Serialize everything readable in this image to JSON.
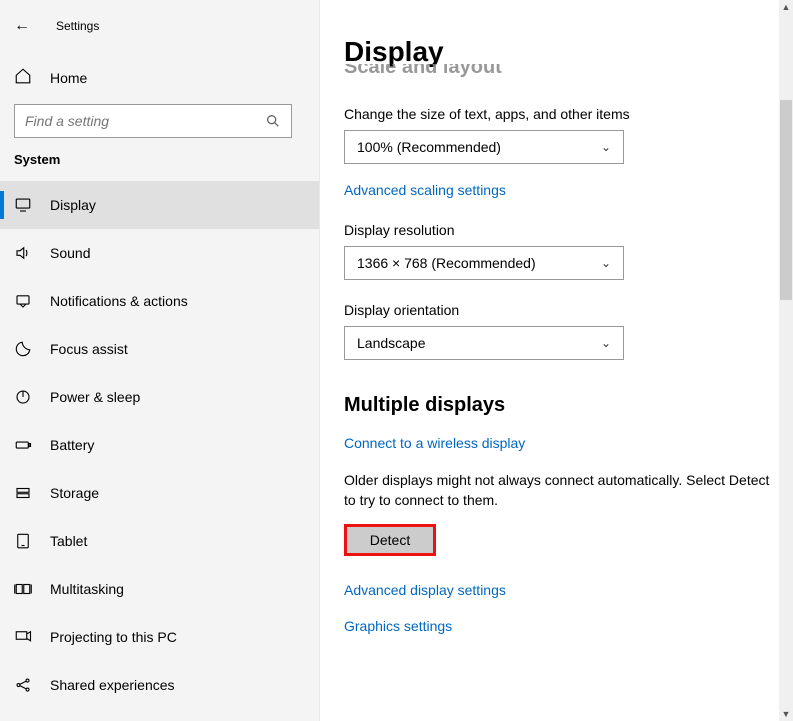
{
  "header": {
    "title": "Settings"
  },
  "sidebar": {
    "home": "Home",
    "search_placeholder": "Find a setting",
    "section": "System",
    "items": [
      {
        "label": "Display"
      },
      {
        "label": "Sound"
      },
      {
        "label": "Notifications & actions"
      },
      {
        "label": "Focus assist"
      },
      {
        "label": "Power & sleep"
      },
      {
        "label": "Battery"
      },
      {
        "label": "Storage"
      },
      {
        "label": "Tablet"
      },
      {
        "label": "Multitasking"
      },
      {
        "label": "Projecting to this PC"
      },
      {
        "label": "Shared experiences"
      }
    ]
  },
  "main": {
    "title": "Display",
    "cutoff_heading": "Scale and layout",
    "scale_label": "Change the size of text, apps, and other items",
    "scale_value": "100% (Recommended)",
    "adv_scaling_link": "Advanced scaling settings",
    "resolution_label": "Display resolution",
    "resolution_value": "1366 × 768 (Recommended)",
    "orientation_label": "Display orientation",
    "orientation_value": "Landscape",
    "multiple_displays_heading": "Multiple displays",
    "wireless_link": "Connect to a wireless display",
    "detect_hint": "Older displays might not always connect automatically. Select Detect to try to connect to them.",
    "detect_button": "Detect",
    "adv_display_link": "Advanced display settings",
    "graphics_link": "Graphics settings"
  }
}
